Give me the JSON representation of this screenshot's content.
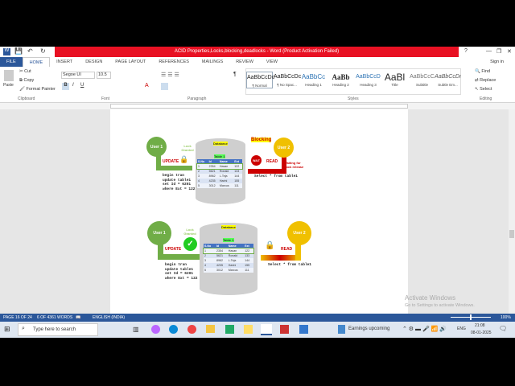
{
  "window": {
    "title": "ACID Properties,Locks,blocking,deadlocks - Word (Product Activation Failed)",
    "sign_in": "Sign in",
    "help": "?",
    "min": "—",
    "max": "❐",
    "close": "✕"
  },
  "tabs": [
    "FILE",
    "HOME",
    "INSERT",
    "DESIGN",
    "PAGE LAYOUT",
    "REFERENCES",
    "MAILINGS",
    "REVIEW",
    "VIEW"
  ],
  "clipboard": {
    "paste": "Paste",
    "cut": "Cut",
    "copy": "Copy",
    "format_painter": "Format Painter",
    "label": "Clipboard"
  },
  "font": {
    "name": "Segoe UI",
    "size": "10.5",
    "label": "Font",
    "bold": "B",
    "italic": "I",
    "underline": "U"
  },
  "paragraph": {
    "label": "Paragraph"
  },
  "styles": {
    "label": "Styles",
    "items": [
      {
        "preview": "AaBbCcDc",
        "name": "¶ Normal"
      },
      {
        "preview": "AaBbCcDc",
        "name": "¶ No Spac..."
      },
      {
        "preview": "AaBbCc",
        "name": "Heading 1"
      },
      {
        "preview": "AaBb",
        "name": "Heading 2"
      },
      {
        "preview": "AaBbCcD",
        "name": "Heading 3"
      },
      {
        "preview": "AaBl",
        "name": "Title"
      },
      {
        "preview": "AaBbCcC",
        "name": "Subtitle"
      },
      {
        "preview": "AaBbCcDı",
        "name": "Subtle Em..."
      }
    ]
  },
  "editing": {
    "find": "Find",
    "replace": "Replace",
    "select": "Select",
    "label": "Editing"
  },
  "diagram1": {
    "user1": "User 1",
    "user2": "User 2",
    "lock": "Lock Granted",
    "database": "Database",
    "table_title": "Table 1",
    "blocking": "Blocking",
    "wait": "WAIT",
    "update": "UPDATE",
    "read": "READ",
    "waiting": "Waiting for Lock release",
    "select": "Select * from table1",
    "code": "begin tran\nupdate table1\nset Id = 6201\nwhere Ext = 122",
    "headers": [
      "S.No",
      "Id",
      "Name",
      "Ext"
    ],
    "rows": [
      [
        "1",
        "2354",
        "Hasan",
        "122"
      ],
      [
        "2",
        "5621",
        "Ronald",
        "133"
      ],
      [
        "3",
        "8962",
        "L.Teja",
        "144"
      ],
      [
        "4",
        "4235",
        "Harini",
        "155"
      ],
      [
        "5",
        "3012",
        "Marcus",
        "111"
      ]
    ]
  },
  "diagram2": {
    "user1": "User 1",
    "user2": "User 2",
    "lock": "Lock Granted",
    "database": "Database",
    "table_title": "Table 1",
    "update": "UPDATE",
    "read": "READ",
    "select": "Select * from table1",
    "code": "begin tran\nupdate table1\nset Id = 6201\nwhere Ext = 122",
    "headers": [
      "S.No",
      "Id",
      "Name",
      "Ext"
    ],
    "rows": [
      [
        "1",
        "2354",
        "Hasan",
        "122"
      ],
      [
        "2",
        "5621",
        "Ronald",
        "133"
      ],
      [
        "3",
        "8962",
        "L.Teja",
        "144"
      ],
      [
        "4",
        "4235",
        "Harini",
        "155"
      ],
      [
        "5",
        "3012",
        "Marcus",
        "111"
      ]
    ]
  },
  "watermark": {
    "title": "Activate Windows",
    "sub": "Go to Settings to activate Windows."
  },
  "status": {
    "page": "PAGE 16 OF 24",
    "words": "6 OF 4361 WORDS",
    "language": "ENGLISH (INDIA)",
    "zoom": "100%"
  },
  "taskbar": {
    "search_placeholder": "Type here to search",
    "news": "Earnings upcoming",
    "lang": "ENG",
    "time": "21:08",
    "date": "08-01-2025"
  }
}
